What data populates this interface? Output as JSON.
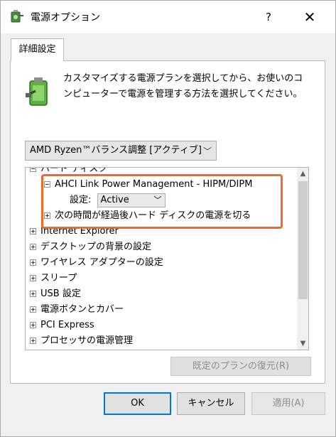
{
  "window": {
    "title": "電源オプション",
    "help_label": "?",
    "close_label": "✕"
  },
  "tab": {
    "label": "詳細設定"
  },
  "description": "カスタマイズする電源プランを選択してから、お使いのコンピューターで電源を管理する方法を選択してください。",
  "plan_select": {
    "value": "AMD Ryzen™バランス調整 [アクティブ]"
  },
  "tree": {
    "items": [
      {
        "label": "ハード ディスク",
        "state": "expanded"
      },
      {
        "label": "AHCI Link Power Management - HIPM/DIPM",
        "state": "expanded"
      },
      {
        "setting_label": "設定:",
        "setting_value": "Active"
      },
      {
        "label": "次の時間が経過後ハード ディスクの電源を切る",
        "state": "collapsed"
      },
      {
        "label": "Internet Explorer",
        "state": "collapsed"
      },
      {
        "label": "デスクトップの背景の設定",
        "state": "collapsed"
      },
      {
        "label": "ワイヤレス アダプターの設定",
        "state": "collapsed"
      },
      {
        "label": "スリープ",
        "state": "collapsed"
      },
      {
        "label": "USB 設定",
        "state": "collapsed"
      },
      {
        "label": "電源ボタンとカバー",
        "state": "collapsed"
      },
      {
        "label": "PCI Express",
        "state": "collapsed"
      },
      {
        "label": "プロセッサの電源管理",
        "state": "collapsed"
      }
    ]
  },
  "buttons": {
    "restore": "既定のプランの復元(R)",
    "ok": "OK",
    "cancel": "キャンセル",
    "apply": "適用(A)"
  },
  "colors": {
    "highlight": "#f26a2a",
    "ok_border": "#0078d7"
  }
}
